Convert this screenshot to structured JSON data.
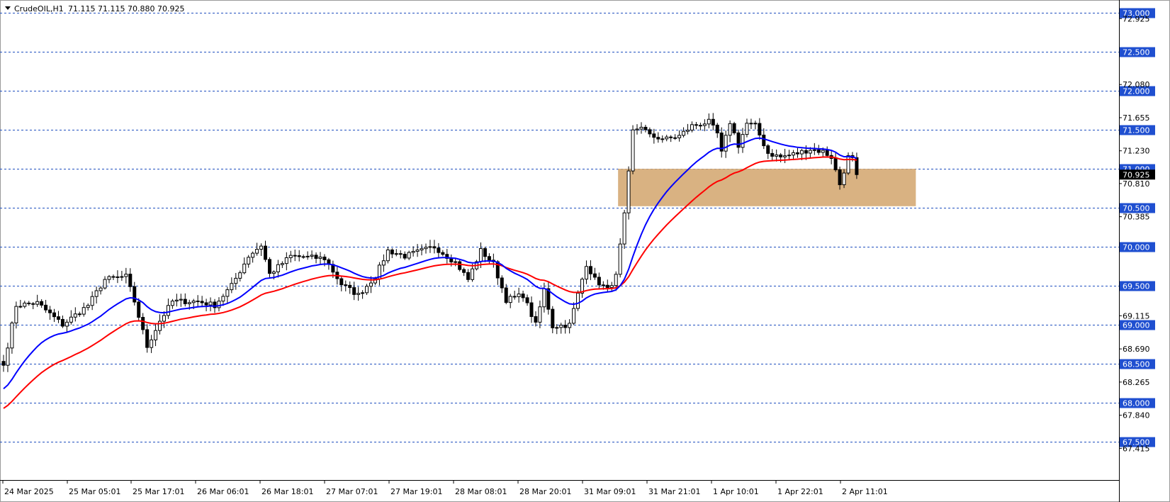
{
  "header": {
    "symbol": "CrudeOIL,H1",
    "ohlc": "71.115 71.115 70.880 70.925"
  },
  "colors": {
    "background": "#ffffff",
    "grid_level": "#1f4fbf",
    "level_tag": "#1f4fd0",
    "ema_fast": "#0000ff",
    "ema_slow": "#ff0000",
    "zone": "#d2a46c",
    "current_price_tag": "#000000",
    "candle_up": "#ffffff",
    "candle_down": "#000000"
  },
  "chart_data": {
    "type": "candlestick",
    "ylim": [
      67.4,
      73.1
    ],
    "price_ticks": [
      "72.925",
      "72.080",
      "71.655",
      "71.230",
      "70.810",
      "70.385",
      "69.115",
      "68.690",
      "68.265",
      "67.840",
      "67.415"
    ],
    "level_lines": [
      "73.000",
      "72.500",
      "72.000",
      "71.500",
      "71.000",
      "70.500",
      "70.000",
      "69.500",
      "69.000",
      "68.500",
      "68.000",
      "67.500"
    ],
    "current_price": "70.925",
    "time_labels": [
      "24 Mar 2025",
      "25 Mar 05:01",
      "25 Mar 17:01",
      "26 Mar 06:01",
      "26 Mar 18:01",
      "27 Mar 07:01",
      "27 Mar 19:01",
      "28 Mar 08:01",
      "28 Mar 20:01",
      "31 Mar 09:01",
      "31 Mar 21:01",
      "1 Apr 10:01",
      "1 Apr 22:01",
      "2 Apr 11:01"
    ],
    "zone": {
      "from_index": 146,
      "to_index": 216,
      "low": 70.52,
      "high": 71.0
    },
    "waypoints": [
      {
        "i": 0,
        "p": 68.48
      },
      {
        "i": 3,
        "p": 69.25
      },
      {
        "i": 8,
        "p": 69.28
      },
      {
        "i": 14,
        "p": 69.0
      },
      {
        "i": 20,
        "p": 69.25
      },
      {
        "i": 24,
        "p": 69.58
      },
      {
        "i": 29,
        "p": 69.62
      },
      {
        "i": 31,
        "p": 69.3
      },
      {
        "i": 34,
        "p": 68.72
      },
      {
        "i": 37,
        "p": 69.05
      },
      {
        "i": 40,
        "p": 69.3
      },
      {
        "i": 46,
        "p": 69.3
      },
      {
        "i": 50,
        "p": 69.25
      },
      {
        "i": 54,
        "p": 69.5
      },
      {
        "i": 58,
        "p": 69.88
      },
      {
        "i": 61,
        "p": 70.02
      },
      {
        "i": 63,
        "p": 69.65
      },
      {
        "i": 68,
        "p": 69.88
      },
      {
        "i": 76,
        "p": 69.85
      },
      {
        "i": 80,
        "p": 69.52
      },
      {
        "i": 84,
        "p": 69.38
      },
      {
        "i": 88,
        "p": 69.62
      },
      {
        "i": 91,
        "p": 69.95
      },
      {
        "i": 95,
        "p": 69.88
      },
      {
        "i": 102,
        "p": 70.0
      },
      {
        "i": 107,
        "p": 69.8
      },
      {
        "i": 110,
        "p": 69.58
      },
      {
        "i": 113,
        "p": 69.95
      },
      {
        "i": 116,
        "p": 69.78
      },
      {
        "i": 119,
        "p": 69.32
      },
      {
        "i": 123,
        "p": 69.38
      },
      {
        "i": 126,
        "p": 69.0
      },
      {
        "i": 128,
        "p": 69.45
      },
      {
        "i": 130,
        "p": 68.98
      },
      {
        "i": 134,
        "p": 69.0
      },
      {
        "i": 138,
        "p": 69.78
      },
      {
        "i": 140,
        "p": 69.58
      },
      {
        "i": 143,
        "p": 69.45
      },
      {
        "i": 145,
        "p": 69.62
      },
      {
        "i": 147,
        "p": 70.4
      },
      {
        "i": 149,
        "p": 71.48
      },
      {
        "i": 151,
        "p": 71.55
      },
      {
        "i": 153,
        "p": 71.42
      },
      {
        "i": 157,
        "p": 71.38
      },
      {
        "i": 160,
        "p": 71.42
      },
      {
        "i": 163,
        "p": 71.55
      },
      {
        "i": 167,
        "p": 71.6
      },
      {
        "i": 169,
        "p": 71.45
      },
      {
        "i": 170,
        "p": 71.2
      },
      {
        "i": 172,
        "p": 71.6
      },
      {
        "i": 174,
        "p": 71.3
      },
      {
        "i": 176,
        "p": 71.58
      },
      {
        "i": 178,
        "p": 71.55
      },
      {
        "i": 181,
        "p": 71.2
      },
      {
        "i": 184,
        "p": 71.15
      },
      {
        "i": 188,
        "p": 71.2
      },
      {
        "i": 191,
        "p": 71.25
      },
      {
        "i": 194,
        "p": 71.22
      },
      {
        "i": 196,
        "p": 71.15
      },
      {
        "i": 198,
        "p": 70.8
      },
      {
        "i": 200,
        "p": 71.15
      },
      {
        "i": 201,
        "p": 71.12
      },
      {
        "i": 202,
        "p": 70.925
      }
    ],
    "ema_fast": {
      "start": 68.15,
      "end": 71.15
    },
    "ema_slow": {
      "start": 67.9,
      "end": 70.78
    }
  }
}
